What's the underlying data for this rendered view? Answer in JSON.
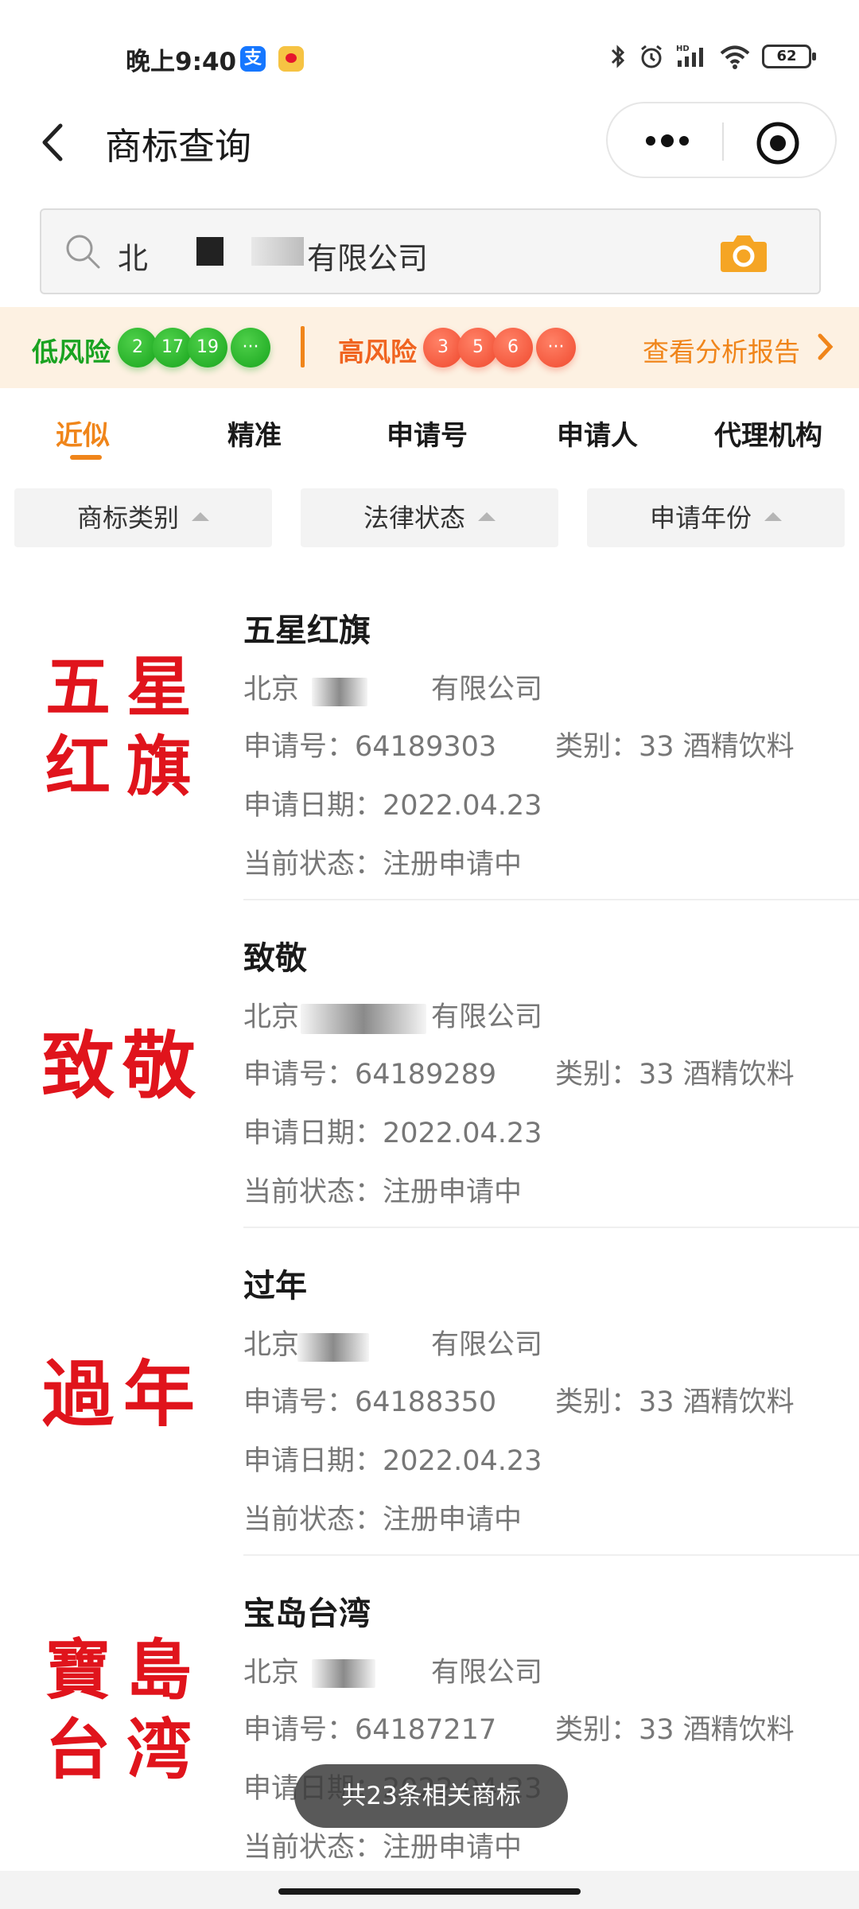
{
  "status_bar": {
    "time": "晚上9:40",
    "battery": "62",
    "pay_icon_letter": "支"
  },
  "nav": {
    "title": "商标查询"
  },
  "search": {
    "value_prefix": "北",
    "value_suffix": "有限公司"
  },
  "risk": {
    "low_label": "低风险",
    "low_counts": [
      "2",
      "17",
      "19",
      "···"
    ],
    "high_label": "高风险",
    "high_counts": [
      "3",
      "5",
      "6",
      "···"
    ],
    "report_link": "查看分析报告"
  },
  "tabs": [
    "近似",
    "精准",
    "申请号",
    "申请人",
    "代理机构"
  ],
  "filters": [
    "商标类别",
    "法律状态",
    "申请年份"
  ],
  "results": [
    {
      "name": "五星红旗",
      "logo_chars": [
        "五",
        "星",
        "红",
        "旗"
      ],
      "applicant_prefix": "北京",
      "applicant_suffix": "有限公司",
      "reg_no": "申请号：64189303",
      "category": "类别：33 酒精饮料",
      "date": "申请日期：2022.04.23",
      "status": "当前状态：注册申请中"
    },
    {
      "name": "致敬",
      "logo_chars": [
        "致",
        "敬"
      ],
      "applicant_prefix": "北京",
      "applicant_suffix": "有限公司",
      "reg_no": "申请号：64189289",
      "category": "类别：33 酒精饮料",
      "date": "申请日期：2022.04.23",
      "status": "当前状态：注册申请中"
    },
    {
      "name": "过年",
      "logo_chars": [
        "過",
        "年"
      ],
      "applicant_prefix": "北京",
      "applicant_suffix": "有限公司",
      "reg_no": "申请号：64188350",
      "category": "类别：33 酒精饮料",
      "date": "申请日期：2022.04.23",
      "status": "当前状态：注册申请中"
    },
    {
      "name": "宝岛台湾",
      "logo_chars": [
        "寶",
        "島",
        "台",
        "湾"
      ],
      "applicant_prefix": "北京",
      "applicant_suffix": "有限公司",
      "reg_no": "申请号：64187217",
      "category": "类别：33 酒精饮料",
      "date": "申请日期：2022.04.23",
      "status": "当前状态：注册申请中"
    }
  ],
  "toast": "共23条相关商标",
  "colors": {
    "accent": "#f0851a",
    "low_risk": "#1aa321",
    "high_risk": "#f06420",
    "logo_red": "#e0141c"
  }
}
